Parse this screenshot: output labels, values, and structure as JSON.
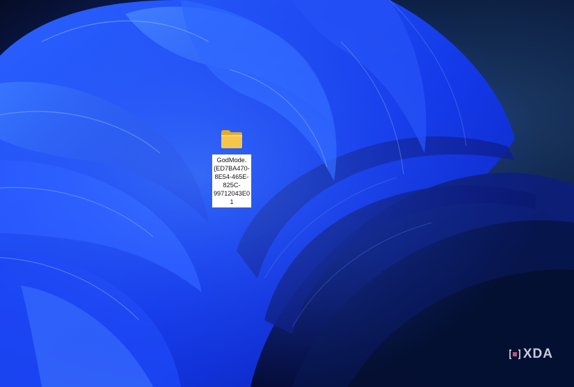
{
  "desktop": {
    "icon": {
      "name": "folder-icon",
      "label": "GodMode.\n{ED7BA470-\n8E54-465E-\n825C-\n99712043E01"
    }
  },
  "watermark": {
    "text": "XDA"
  },
  "colors": {
    "wallpaper_deep": "#050c22",
    "wallpaper_blue": "#1a3cff",
    "wallpaper_bright": "#3f79ff",
    "folder_yellow": "#f5c64a"
  }
}
